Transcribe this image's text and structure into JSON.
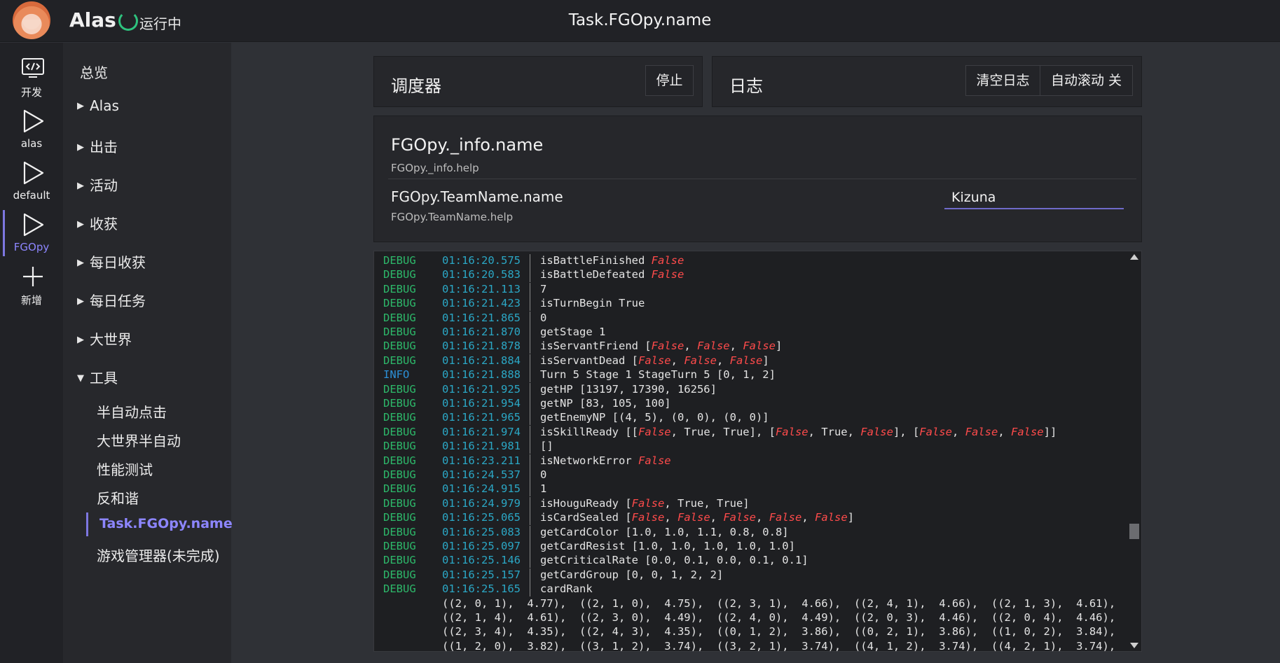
{
  "header": {
    "app_title": "Alas",
    "status": "运行中",
    "task_title": "Task.FGOpy.name"
  },
  "rail": [
    {
      "label": "开发",
      "icon": "code-icon"
    },
    {
      "label": "alas",
      "icon": "play-icon"
    },
    {
      "label": "default",
      "icon": "play-icon"
    },
    {
      "label": "FGOpy",
      "icon": "play-icon",
      "active": true
    },
    {
      "label": "新增",
      "icon": "plus-icon"
    }
  ],
  "nav": {
    "overview": "总览",
    "groups": [
      "Alas",
      "出击",
      "活动",
      "收获",
      "每日收获",
      "每日任务",
      "大世界",
      "工具"
    ],
    "tools": [
      "半自动点击",
      "大世界半自动",
      "性能测试",
      "反和谐",
      "Task.FGOpy.name",
      "游戏管理器(未完成)"
    ]
  },
  "scheduler": {
    "title": "调度器",
    "stop_label": "停止"
  },
  "logpanel": {
    "title": "日志",
    "clear_label": "清空日志",
    "autoscroll_label": "自动滚动 关"
  },
  "config": {
    "group_title": "FGOpy._info.name",
    "group_help": "FGOpy._info.help",
    "field_title": "FGOpy.TeamName.name",
    "field_help": "FGOpy.TeamName.help",
    "field_value": "Kizuna"
  },
  "colors": {
    "accent": "#8d86ff",
    "debug": "#2db86a",
    "info": "#2c8fd6",
    "timestamp": "#2ba7c5",
    "false": "#ff4b4b",
    "running": "#2ec27e"
  },
  "log": [
    {
      "level": "DEBUG",
      "time": "01:16:20.575",
      "msg": [
        [
          "isBattleFinished ",
          false
        ],
        [
          "False",
          true
        ]
      ]
    },
    {
      "level": "DEBUG",
      "time": "01:16:20.583",
      "msg": [
        [
          "isBattleDefeated ",
          false
        ],
        [
          "False",
          true
        ]
      ]
    },
    {
      "level": "DEBUG",
      "time": "01:16:21.113",
      "msg": [
        [
          "7",
          false
        ]
      ]
    },
    {
      "level": "DEBUG",
      "time": "01:16:21.423",
      "msg": [
        [
          "isTurnBegin True",
          false
        ]
      ]
    },
    {
      "level": "DEBUG",
      "time": "01:16:21.865",
      "msg": [
        [
          "0",
          false
        ]
      ]
    },
    {
      "level": "DEBUG",
      "time": "01:16:21.870",
      "msg": [
        [
          "getStage 1",
          false
        ]
      ]
    },
    {
      "level": "DEBUG",
      "time": "01:16:21.878",
      "msg": [
        [
          "isServantFriend [",
          false
        ],
        [
          "False",
          true
        ],
        [
          ", ",
          false
        ],
        [
          "False",
          true
        ],
        [
          ", ",
          false
        ],
        [
          "False",
          true
        ],
        [
          "]",
          false
        ]
      ]
    },
    {
      "level": "DEBUG",
      "time": "01:16:21.884",
      "msg": [
        [
          "isServantDead [",
          false
        ],
        [
          "False",
          true
        ],
        [
          ", ",
          false
        ],
        [
          "False",
          true
        ],
        [
          ", ",
          false
        ],
        [
          "False",
          true
        ],
        [
          "]",
          false
        ]
      ]
    },
    {
      "level": "INFO",
      "time": "01:16:21.888",
      "msg": [
        [
          "Turn 5 Stage 1 StageTurn 5 [0, 1, 2]",
          false
        ]
      ]
    },
    {
      "level": "DEBUG",
      "time": "01:16:21.925",
      "msg": [
        [
          "getHP [13197, 17390, 16256]",
          false
        ]
      ]
    },
    {
      "level": "DEBUG",
      "time": "01:16:21.954",
      "msg": [
        [
          "getNP [83, 105, 100]",
          false
        ]
      ]
    },
    {
      "level": "DEBUG",
      "time": "01:16:21.965",
      "msg": [
        [
          "getEnemyNP [(4, 5), (0, 0), (0, 0)]",
          false
        ]
      ]
    },
    {
      "level": "DEBUG",
      "time": "01:16:21.974",
      "msg": [
        [
          "isSkillReady [[",
          false
        ],
        [
          "False",
          true
        ],
        [
          ", True, True], [",
          false
        ],
        [
          "False",
          true
        ],
        [
          ", True, ",
          false
        ],
        [
          "False",
          true
        ],
        [
          "], [",
          false
        ],
        [
          "False",
          true
        ],
        [
          ", ",
          false
        ],
        [
          "False",
          true
        ],
        [
          ", ",
          false
        ],
        [
          "False",
          true
        ],
        [
          "]]",
          false
        ]
      ]
    },
    {
      "level": "DEBUG",
      "time": "01:16:21.981",
      "msg": [
        [
          "[]",
          false
        ]
      ]
    },
    {
      "level": "DEBUG",
      "time": "01:16:23.211",
      "msg": [
        [
          "isNetworkError ",
          false
        ],
        [
          "False",
          true
        ]
      ]
    },
    {
      "level": "DEBUG",
      "time": "01:16:24.537",
      "msg": [
        [
          "0",
          false
        ]
      ]
    },
    {
      "level": "DEBUG",
      "time": "01:16:24.915",
      "msg": [
        [
          "1",
          false
        ]
      ]
    },
    {
      "level": "DEBUG",
      "time": "01:16:24.979",
      "msg": [
        [
          "isHouguReady [",
          false
        ],
        [
          "False",
          true
        ],
        [
          ", True, True]",
          false
        ]
      ]
    },
    {
      "level": "DEBUG",
      "time": "01:16:25.065",
      "msg": [
        [
          "isCardSealed [",
          false
        ],
        [
          "False",
          true
        ],
        [
          ", ",
          false
        ],
        [
          "False",
          true
        ],
        [
          ", ",
          false
        ],
        [
          "False",
          true
        ],
        [
          ", ",
          false
        ],
        [
          "False",
          true
        ],
        [
          ", ",
          false
        ],
        [
          "False",
          true
        ],
        [
          "]",
          false
        ]
      ]
    },
    {
      "level": "DEBUG",
      "time": "01:16:25.083",
      "msg": [
        [
          "getCardColor [1.0, 1.0, 1.1, 0.8, 0.8]",
          false
        ]
      ]
    },
    {
      "level": "DEBUG",
      "time": "01:16:25.097",
      "msg": [
        [
          "getCardResist [1.0, 1.0, 1.0, 1.0, 1.0]",
          false
        ]
      ]
    },
    {
      "level": "DEBUG",
      "time": "01:16:25.146",
      "msg": [
        [
          "getCriticalRate [0.0, 0.1, 0.0, 0.1, 0.1]",
          false
        ]
      ]
    },
    {
      "level": "DEBUG",
      "time": "01:16:25.157",
      "msg": [
        [
          "getCardGroup [0, 0, 1, 2, 2]",
          false
        ]
      ]
    },
    {
      "level": "DEBUG",
      "time": "01:16:25.165",
      "msg": [
        [
          "cardRank",
          false
        ]
      ]
    }
  ],
  "log_continuation": [
    "((2, 0, 1),  4.77),  ((2, 1, 0),  4.75),  ((2, 3, 1),  4.66),  ((2, 4, 1),  4.66),  ((2, 1, 3),  4.61),",
    "((2, 1, 4),  4.61),  ((2, 3, 0),  4.49),  ((2, 4, 0),  4.49),  ((2, 0, 3),  4.46),  ((2, 0, 4),  4.46),",
    "((2, 3, 4),  4.35),  ((2, 4, 3),  4.35),  ((0, 1, 2),  3.86),  ((0, 2, 1),  3.86),  ((1, 0, 2),  3.84),",
    "((1, 2, 0),  3.82),  ((3, 1, 2),  3.74),  ((3, 2, 1),  3.74),  ((4, 1, 2),  3.74),  ((4, 2, 1),  3.74),"
  ]
}
